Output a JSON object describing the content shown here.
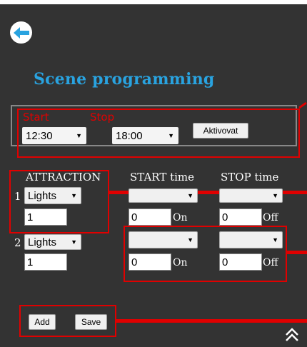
{
  "page": {
    "title": "Scene programming"
  },
  "schedule": {
    "start_label": "Start",
    "stop_label": "Stop",
    "start_value": "12:30",
    "stop_value": "18:00",
    "activate_label": "Aktivovat"
  },
  "table": {
    "headers": {
      "attraction": "ATTRACTION",
      "start": "START time",
      "stop": "STOP time"
    },
    "rows": [
      {
        "number": "1",
        "attraction": "Lights",
        "count": "1",
        "start_value": "",
        "stop_value": "",
        "on_value": "0",
        "on_label": "On",
        "off_value": "0",
        "off_label": "Off"
      },
      {
        "number": "2",
        "attraction": "Lights",
        "count": "1",
        "start_value": "",
        "stop_value": "",
        "on_value": "0",
        "on_label": "On",
        "off_value": "0",
        "off_label": "Off"
      }
    ]
  },
  "actions": {
    "add_label": "Add",
    "save_label": "Save"
  },
  "icons": {
    "back": "back-arrow-icon",
    "scroll_up": "double-chevron-up-icon"
  },
  "colors": {
    "background": "#333333",
    "title": "#29a3e0",
    "highlight": "#e00000"
  }
}
